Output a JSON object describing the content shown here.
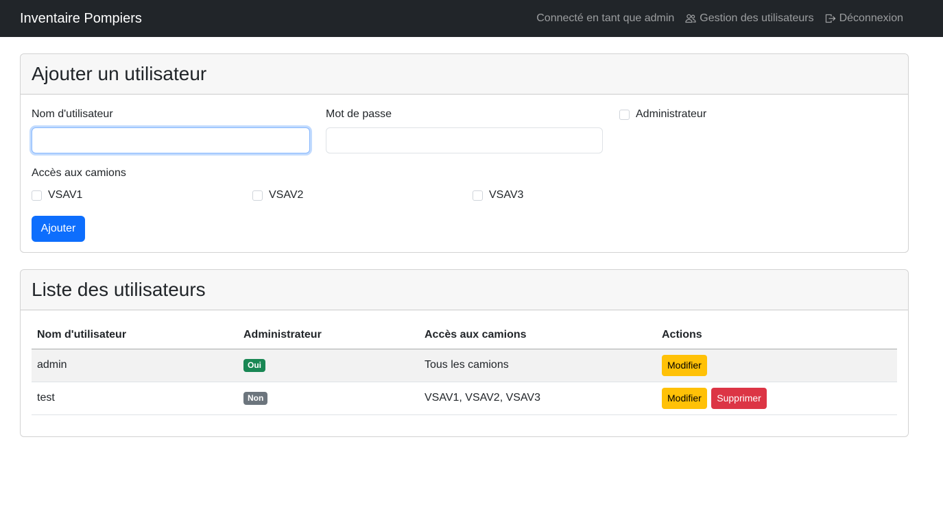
{
  "navbar": {
    "brand": "Inventaire Pompiers",
    "logged_in_text": "Connecté en tant que admin",
    "user_management_label": "Gestion des utilisateurs",
    "logout_label": "Déconnexion"
  },
  "add_user": {
    "title": "Ajouter un utilisateur",
    "username_label": "Nom d'utilisateur",
    "username_value": "",
    "password_label": "Mot de passe",
    "password_value": "",
    "admin_label": "Administrateur",
    "trucks_label": "Accès aux camions",
    "trucks": [
      "VSAV1",
      "VSAV2",
      "VSAV3"
    ],
    "submit_label": "Ajouter"
  },
  "user_list": {
    "title": "Liste des utilisateurs",
    "columns": [
      "Nom d'utilisateur",
      "Administrateur",
      "Accès aux camions",
      "Actions"
    ],
    "rows": [
      {
        "username": "admin",
        "admin_badge": "Oui",
        "trucks": "Tous les camions",
        "edit_label": "Modifier"
      },
      {
        "username": "test",
        "admin_badge": "Non",
        "trucks": "VSAV1, VSAV2, VSAV3",
        "edit_label": "Modifier",
        "delete_label": "Supprimer"
      }
    ]
  },
  "colors": {
    "navbar_bg": "#212529",
    "primary": "#0d6efd",
    "success": "#198754",
    "secondary": "#6c757d",
    "warning": "#ffc107",
    "danger": "#dc3545"
  },
  "icons": {
    "user_management": "people-icon",
    "logout": "box-arrow-right-icon"
  }
}
